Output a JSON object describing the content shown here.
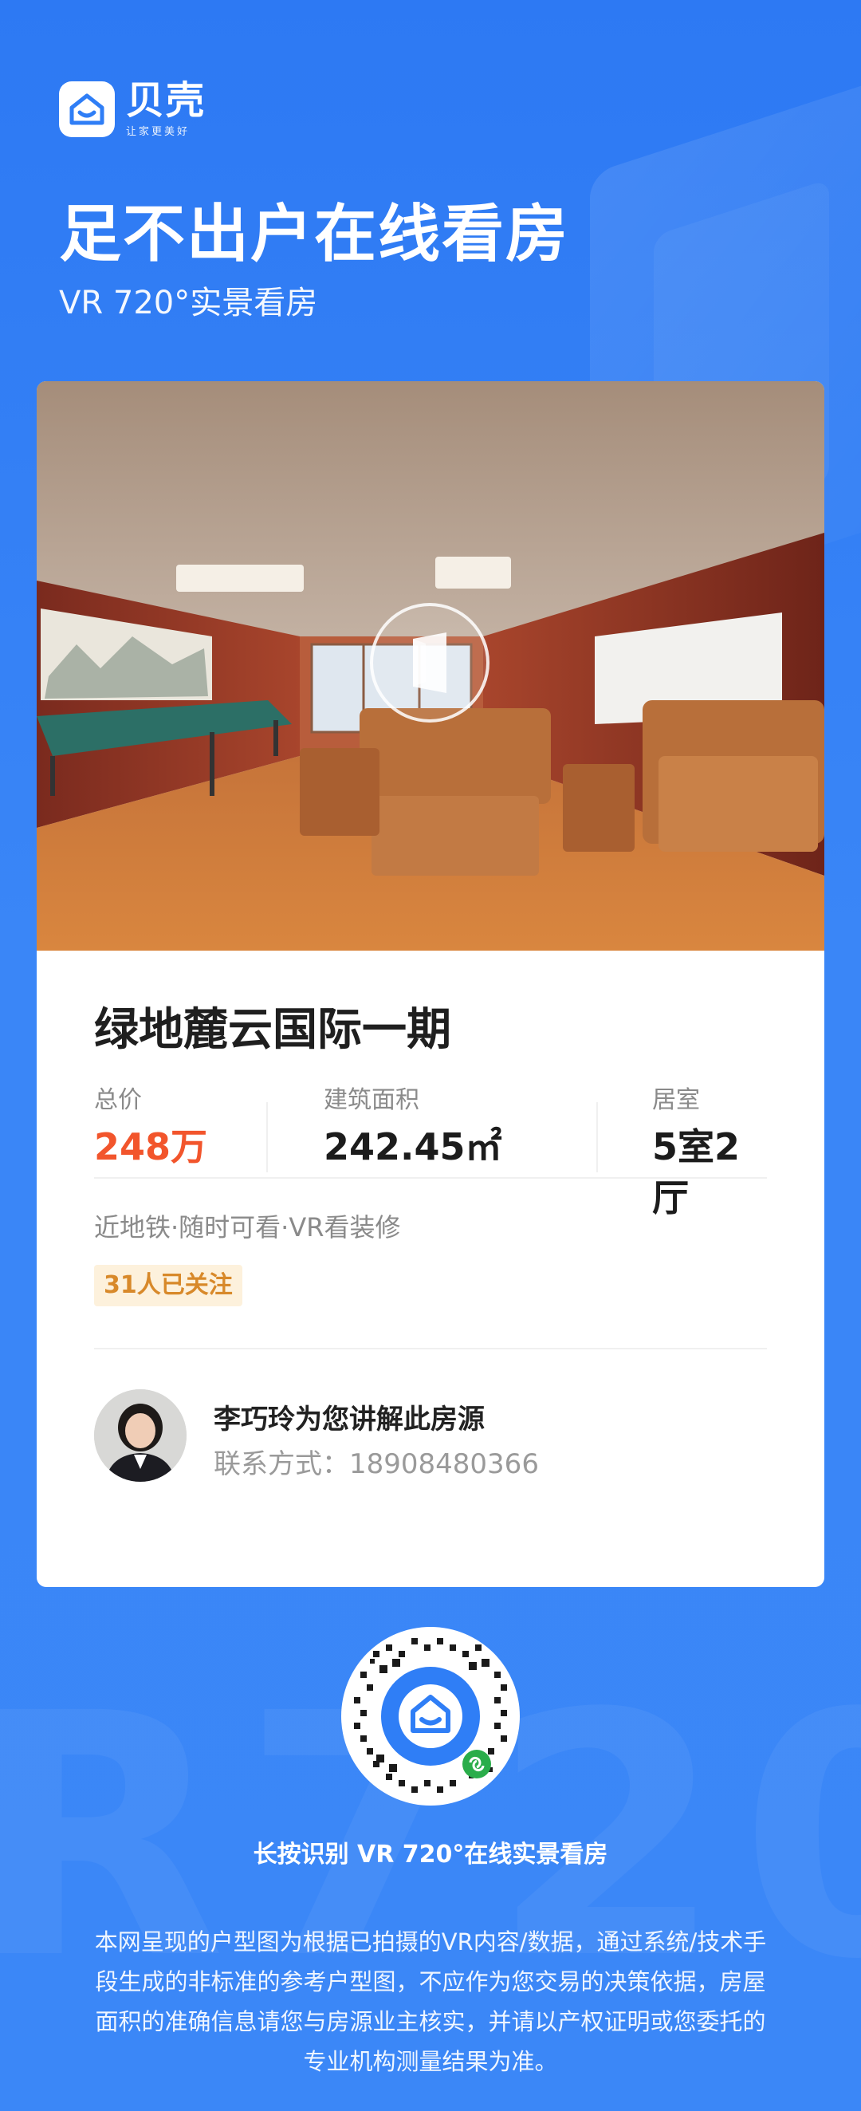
{
  "brand": {
    "name": "贝壳",
    "slogan": "让家更美好"
  },
  "header": {
    "headline": "足不出户在线看房",
    "subline": "VR 720°实景看房"
  },
  "listing": {
    "title": "绿地麓云国际一期",
    "stats": [
      {
        "label": "总价",
        "value": "248万"
      },
      {
        "label": "建筑面积",
        "value": "242.45㎡"
      },
      {
        "label": "居室",
        "value": "5室2厅"
      }
    ],
    "tags": "近地铁·随时可看·VR看装修",
    "followers": "31人已关注"
  },
  "agent": {
    "intro": "李巧玲为您讲解此房源",
    "contact": "联系方式：18908480366"
  },
  "qr": {
    "caption": "长按识别 VR 720°在线实景看房"
  },
  "disclaimer": "本网呈现的户型图为根据已拍摄的VR内容/数据，通过系统/技术手段生成的非标准的参考户型图，不应作为您交易的决策依据，房屋面积的准确信息请您与房源业主核实，并请以产权证明或您委托的专业机构测量结果为准。",
  "colors": {
    "accent": "#2f7ef6",
    "price": "#f2552c",
    "badge_text": "#d8892a",
    "badge_bg": "#fdf1dc"
  },
  "watermark": "R720"
}
